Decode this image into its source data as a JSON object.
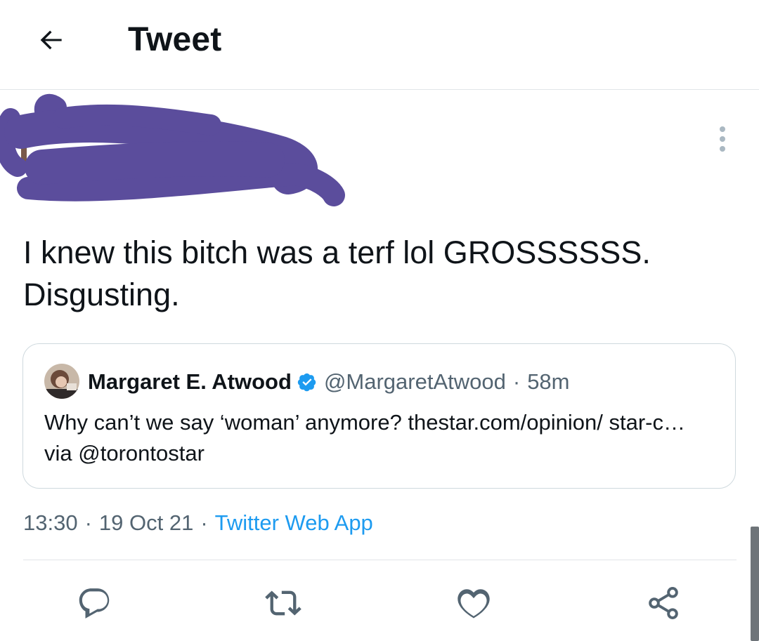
{
  "header": {
    "title": "Tweet",
    "back_icon": "arrow-left-icon"
  },
  "tweet": {
    "text": "I knew this bitch was a terf lol GROSSSSSS. Disgusting.",
    "timestamp": "13:30",
    "date": "19 Oct 21",
    "source": "Twitter Web App",
    "separator": "·"
  },
  "quote": {
    "name": "Margaret E. Atwood",
    "handle": "@MargaretAtwood",
    "time": "58m",
    "separator": "·",
    "text": "Why can’t we say ‘woman’ anymore? thestar.com/opinion/ star-c… via @torontostar"
  },
  "actions": {
    "icons": [
      "reply-icon",
      "retweet-icon",
      "like-icon",
      "share-icon"
    ]
  },
  "colors": {
    "link": "#1d9bf0",
    "secondary_text": "#536471",
    "redaction": "#5b4d9c",
    "border": "#cfd9de"
  }
}
